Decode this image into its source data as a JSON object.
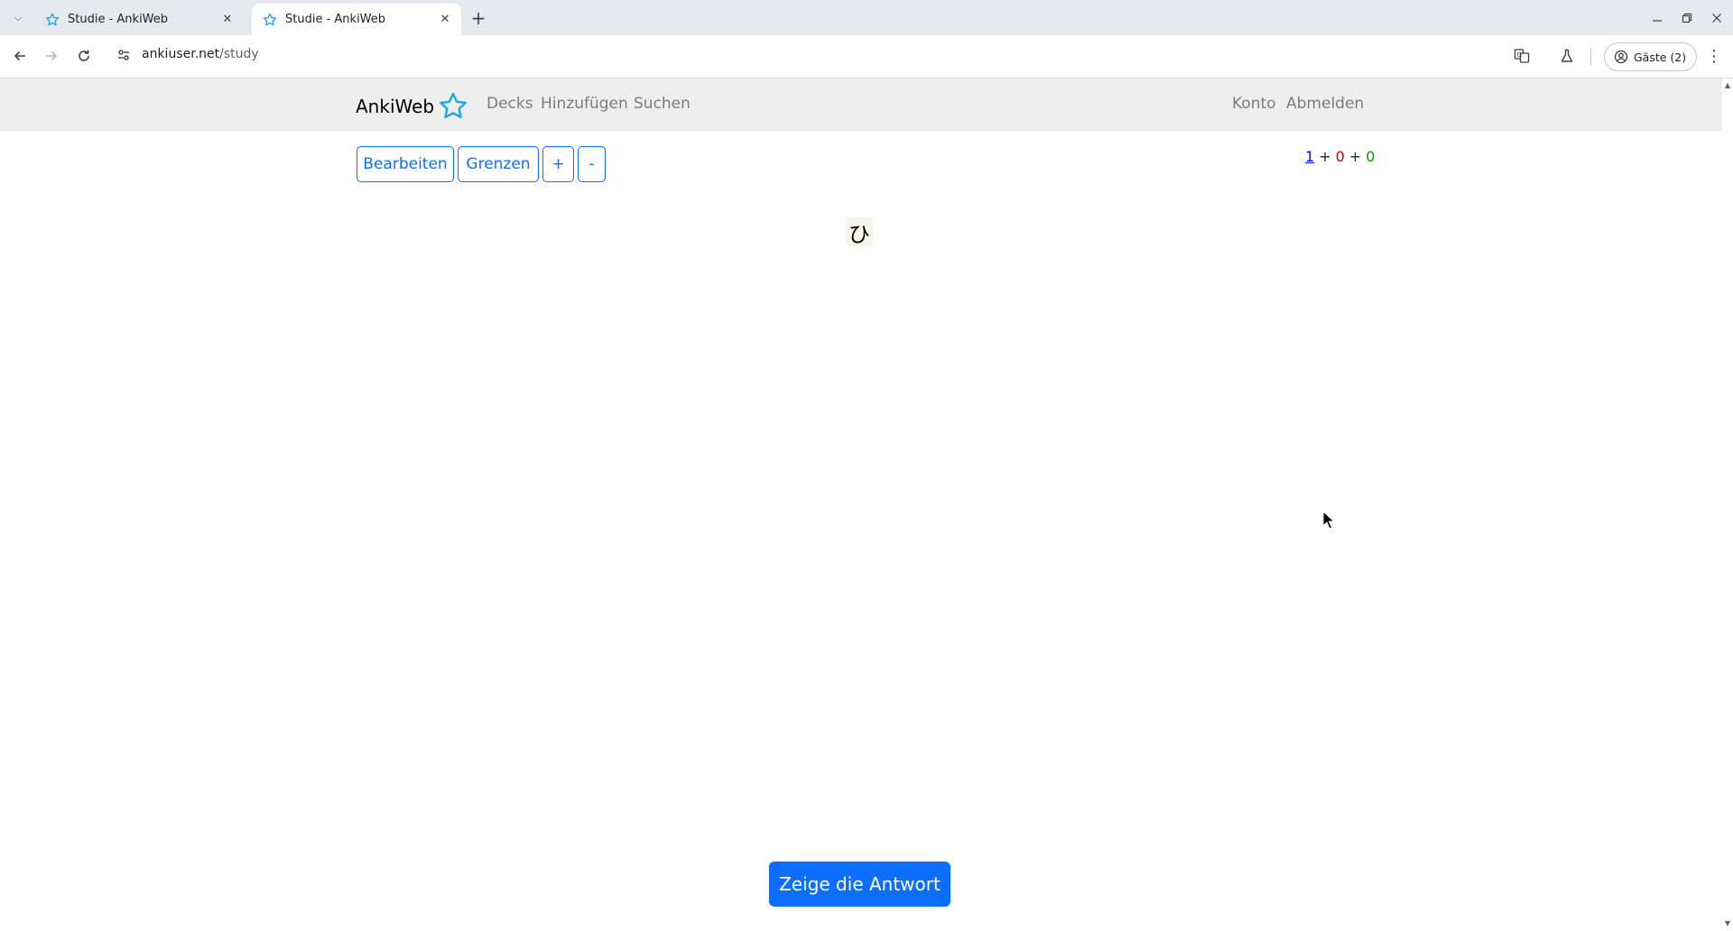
{
  "browser": {
    "tabs": [
      {
        "title": "Studie - AnkiWeb",
        "active": false
      },
      {
        "title": "Studie - AnkiWeb",
        "active": true
      }
    ],
    "url_host": "ankiuser.net",
    "url_path": "/study",
    "profile_label": "Gäste (2)"
  },
  "site": {
    "brand": "AnkiWeb",
    "nav": {
      "decks": "Decks",
      "add": "Hinzufügen",
      "search": "Suchen",
      "account": "Konto",
      "logout": "Abmelden"
    }
  },
  "study": {
    "buttons": {
      "edit": "Bearbeiten",
      "limits": "Grenzen",
      "plus": "+",
      "minus": "-"
    },
    "counts": {
      "new": "1",
      "learning": "0",
      "review": "0",
      "sep": "+"
    },
    "card_front": "ひ",
    "show_answer": "Zeige die Antwort"
  },
  "colors": {
    "accent": "#0d6efd",
    "brand_star": "#1aa7e8",
    "count_new": "#0000ff",
    "count_learning": "#cc0000",
    "count_review": "#009900"
  }
}
